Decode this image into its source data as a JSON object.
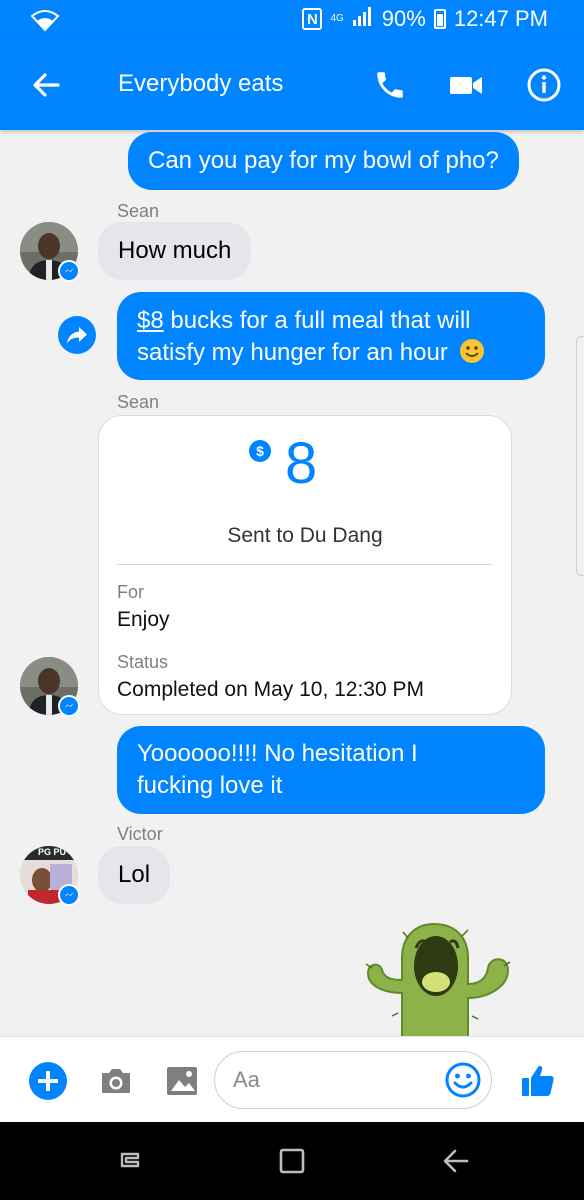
{
  "status_bar": {
    "nfc_label": "N",
    "network_label": "4G",
    "battery": "90%",
    "time": "12:47 PM"
  },
  "header": {
    "title": "Everybody eats"
  },
  "messages": {
    "m1_text": "Can you pay for my bowl of pho?",
    "sender_sean_1": "Sean",
    "m2_text": "How much",
    "m3_amount_link": "$8",
    "m3_line1_rest": " bucks for a full meal that will",
    "m3_line2": "satisfy my hunger for an hour",
    "sender_sean_2": "Sean",
    "m5_line1": "Yoooooo!!!! No hesitation I",
    "m5_line2": "fucking love it",
    "sender_victor": "Victor",
    "m6_text": "Lol"
  },
  "payment": {
    "currency_symbol": "$",
    "amount": "8",
    "sent_to": "Sent to Du Dang",
    "for_label": "For",
    "for_value": "Enjoy",
    "status_label": "Status",
    "status_value": "Completed on May 10, 12:30 PM"
  },
  "avatars": {
    "victor_avatar_text": "PG PU"
  },
  "composer": {
    "placeholder": "Aa"
  },
  "colors": {
    "accent": "#0084ff",
    "incoming_bubble": "#e4e6eb",
    "background": "#f1f1f1"
  }
}
